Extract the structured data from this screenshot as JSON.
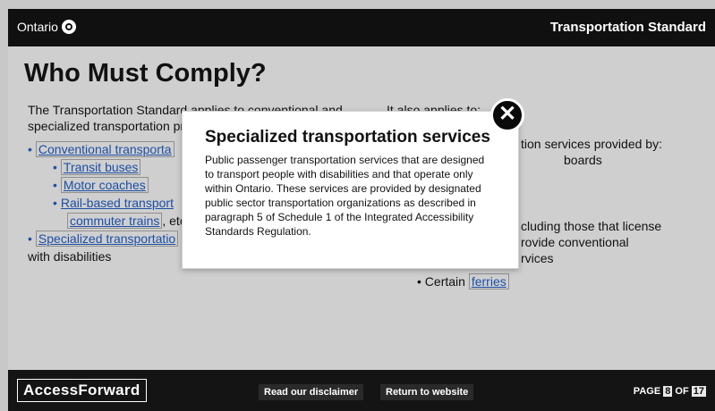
{
  "header": {
    "brand": "Ontario",
    "title": "Transportation Standard"
  },
  "main": {
    "heading": "Who Must Comply?",
    "left_intro": "The Transportation Standard applies to conventional and specialized transportation providers that operate sol",
    "left_items": [
      {
        "label": "Conventional transporta"
      },
      {
        "label": "Transit buses"
      },
      {
        "label": "Motor coaches"
      },
      {
        "label": "Rail-based transport"
      },
      {
        "label": "commuter trains",
        "suffix": ", etc"
      },
      {
        "label": "Specialized transportatio"
      }
    ],
    "left_tail": "with disabilities",
    "right_intro": "It also applies to:",
    "right_lines": [
      "tion services provided by:",
      "boards",
      "cluding those that license",
      "rovide conventional",
      "rvices"
    ],
    "ferries_prefix": "Certain",
    "ferries_link": "ferries"
  },
  "modal": {
    "title": "Specialized transportation services",
    "body": "Public passenger transportation services that are designed to transport people with disabilities and that operate only within Ontario. These services are provided by designated public sector transportation organizations as described in paragraph 5 of Schedule 1 of the Integrated Accessibility Standards Regulation.",
    "close_glyph": "✕"
  },
  "footer": {
    "brand": "AccessForward",
    "disclaimer_btn": "Read our disclaimer",
    "return_btn": "Return to website",
    "page_label": "PAGE",
    "page_current": "8",
    "page_of": "OF",
    "page_total": "17"
  },
  "colors": {
    "accent_link": "#1c4fa6",
    "header_bg": "#101010"
  }
}
